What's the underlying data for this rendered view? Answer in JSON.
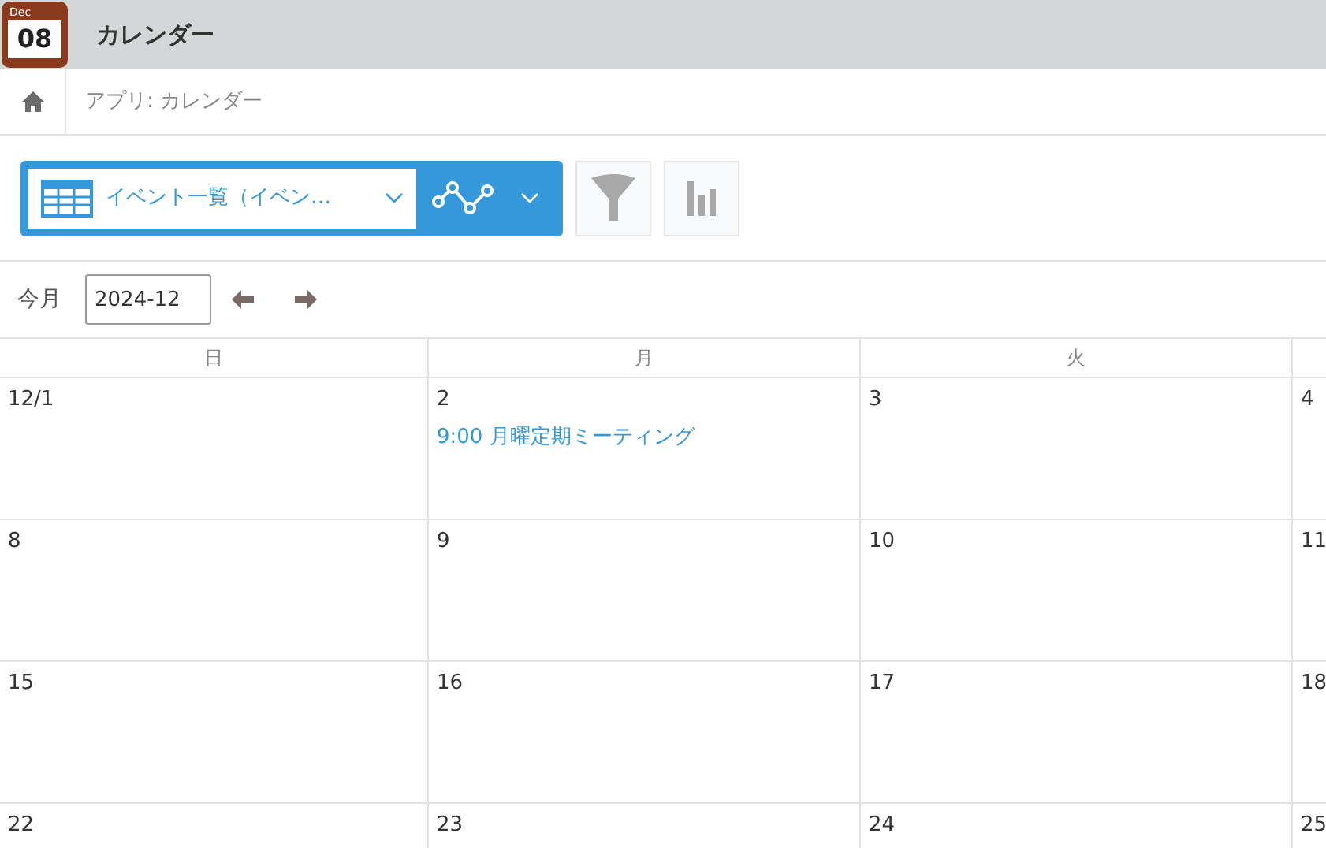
{
  "app": {
    "icon_month": "Dec",
    "icon_day": "08",
    "title": "カレンダー"
  },
  "breadcrumb": {
    "label": "アプリ: カレンダー"
  },
  "toolbar": {
    "view_name": "イベント一覧（イベン…"
  },
  "month_nav": {
    "today_label": "今月",
    "month_value": "2024-12"
  },
  "calendar": {
    "weekdays": [
      "日",
      "月",
      "火"
    ],
    "weeks": [
      [
        {
          "date": "12/1"
        },
        {
          "date": "2",
          "events": [
            "9:00 月曜定期ミーティング"
          ]
        },
        {
          "date": "3"
        },
        {
          "date": "4"
        }
      ],
      [
        {
          "date": "8"
        },
        {
          "date": "9"
        },
        {
          "date": "10"
        },
        {
          "date": "11"
        }
      ],
      [
        {
          "date": "15"
        },
        {
          "date": "16"
        },
        {
          "date": "17"
        },
        {
          "date": "18"
        }
      ],
      [
        {
          "date": "22"
        },
        {
          "date": "23"
        },
        {
          "date": "24"
        },
        {
          "date": "25"
        }
      ]
    ]
  }
}
